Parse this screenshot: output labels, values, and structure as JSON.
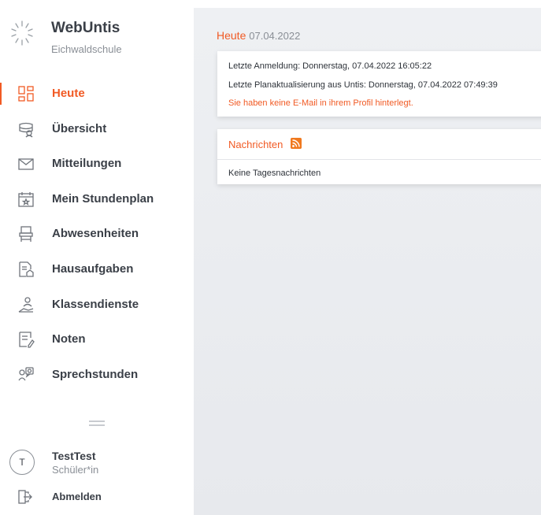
{
  "app": {
    "title": "WebUntis",
    "school": "Eichwaldschule"
  },
  "sidebar": {
    "items": [
      {
        "label": "Heute",
        "icon": "dashboard-icon",
        "active": true
      },
      {
        "label": "Übersicht",
        "icon": "overview-icon",
        "active": false
      },
      {
        "label": "Mitteilungen",
        "icon": "mail-icon",
        "active": false
      },
      {
        "label": "Mein Stundenplan",
        "icon": "calendar-icon",
        "active": false
      },
      {
        "label": "Abwesenheiten",
        "icon": "chair-icon",
        "active": false
      },
      {
        "label": "Hausaufgaben",
        "icon": "homework-icon",
        "active": false
      },
      {
        "label": "Klassendienste",
        "icon": "class-duty-icon",
        "active": false
      },
      {
        "label": "Noten",
        "icon": "grades-icon",
        "active": false
      },
      {
        "label": "Sprechstunden",
        "icon": "consultation-icon",
        "active": false
      }
    ]
  },
  "user": {
    "initial": "T",
    "name": "TestTest",
    "role": "Schüler*in"
  },
  "logout": {
    "label": "Abmelden"
  },
  "main": {
    "title": "Heute",
    "date": "07.04.2022",
    "info": {
      "last_login": "Letzte Anmeldung: Donnerstag, 07.04.2022 16:05:22",
      "last_update": "Letzte Planaktualisierung aus Untis: Donnerstag, 07.04.2022 07:49:39",
      "warning": "Sie haben keine E-Mail in ihrem Profil hinterlegt."
    },
    "news": {
      "title": "Nachrichten",
      "empty": "Keine Tagesnachrichten"
    }
  },
  "colors": {
    "accent": "#f15a24",
    "text": "#3a3f47",
    "muted": "#8a8f96",
    "background": "#eef0f3"
  }
}
